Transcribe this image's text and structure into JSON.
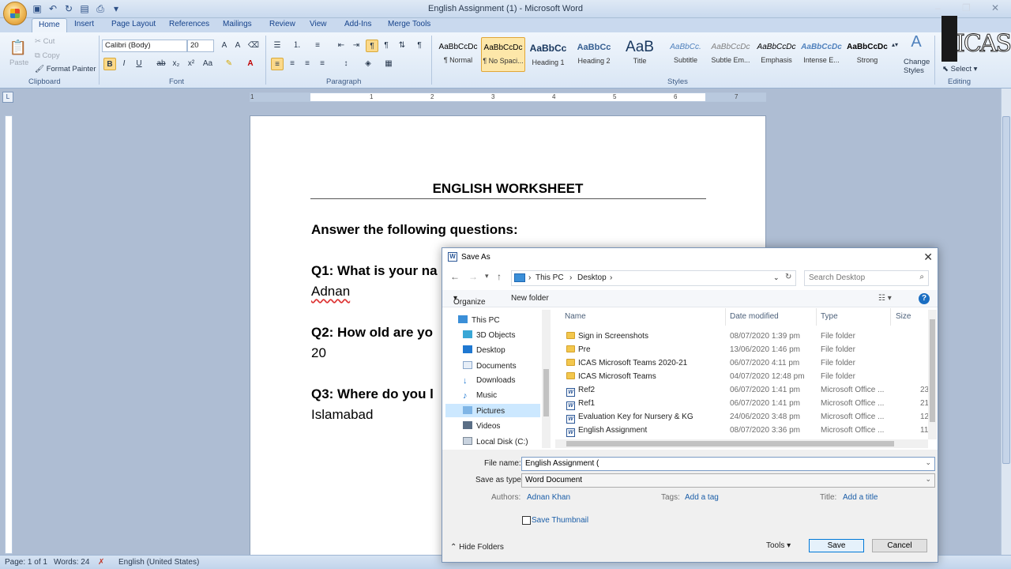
{
  "window": {
    "title": "English Assignment (1) - Microsoft Word"
  },
  "ribbon": {
    "tabs": [
      "Home",
      "Insert",
      "Page Layout",
      "References",
      "Mailings",
      "Review",
      "View",
      "Add-Ins",
      "Merge Tools"
    ],
    "clipboard": {
      "paste": "Paste",
      "cut": "Cut",
      "copy": "Copy",
      "format_painter": "Format Painter",
      "label": "Clipboard"
    },
    "font": {
      "name": "Calibri (Body)",
      "size": "20",
      "label": "Font"
    },
    "paragraph": {
      "label": "Paragraph"
    },
    "styles": {
      "items": [
        {
          "preview": "AaBbCcDc",
          "name": "¶ Normal"
        },
        {
          "preview": "AaBbCcDc",
          "name": "¶ No Spaci..."
        },
        {
          "preview": "AaBbCc",
          "name": "Heading 1"
        },
        {
          "preview": "AaBbCc",
          "name": "Heading 2"
        },
        {
          "preview": "AaB",
          "name": "Title"
        },
        {
          "preview": "AaBbCc.",
          "name": "Subtitle"
        },
        {
          "preview": "AaBbCcDc",
          "name": "Subtle Em..."
        },
        {
          "preview": "AaBbCcDc",
          "name": "Emphasis"
        },
        {
          "preview": "AaBbCcDc",
          "name": "Intense E..."
        },
        {
          "preview": "AaBbCcDc",
          "name": "Strong"
        }
      ],
      "change_styles": "Change Styles",
      "label": "Styles"
    },
    "editing": {
      "select": "Select",
      "label": "Editing"
    }
  },
  "ruler": {
    "numbers": [
      "1",
      "1",
      "2",
      "3",
      "4",
      "5",
      "6",
      "7"
    ]
  },
  "document": {
    "title": "ENGLISH WORKSHEET",
    "lines": [
      {
        "text": "Answer the following questions:",
        "bold": true
      },
      {
        "text": "Q1: What is your na",
        "bold": true
      },
      {
        "text": "Adnan",
        "bold": false
      },
      {
        "text": "Q2: How old are yo",
        "bold": true
      },
      {
        "text": "20",
        "bold": false
      },
      {
        "text": "Q3: Where do you l",
        "bold": true
      },
      {
        "text": "Islamabad",
        "bold": false
      }
    ]
  },
  "status": {
    "page": "Page: 1 of 1",
    "words": "Words: 24",
    "language": "English (United States)"
  },
  "dialog": {
    "title": "Save As",
    "address": {
      "crumbs": [
        "This PC",
        "Desktop"
      ]
    },
    "search_placeholder": "Search Desktop",
    "toolbar": {
      "organize": "Organize",
      "new_folder": "New folder"
    },
    "nav": [
      "This PC",
      "3D Objects",
      "Desktop",
      "Documents",
      "Downloads",
      "Music",
      "Pictures",
      "Videos",
      "Local Disk (C:)"
    ],
    "columns": [
      "Name",
      "Date modified",
      "Type",
      "Size"
    ],
    "files": [
      {
        "name": "Sign in Screenshots",
        "date": "08/07/2020 1:39 pm",
        "type": "File folder",
        "size": "",
        "kind": "folder"
      },
      {
        "name": "Pre",
        "date": "13/06/2020 1:46 pm",
        "type": "File folder",
        "size": "",
        "kind": "folder"
      },
      {
        "name": "ICAS Microsoft Teams 2020-21",
        "date": "06/07/2020 4:11 pm",
        "type": "File folder",
        "size": "",
        "kind": "folder"
      },
      {
        "name": "ICAS Microsoft Teams",
        "date": "04/07/2020 12:48 pm",
        "type": "File folder",
        "size": "",
        "kind": "folder"
      },
      {
        "name": "Ref2",
        "date": "06/07/2020 1:41 pm",
        "type": "Microsoft Office ...",
        "size": "23",
        "kind": "word"
      },
      {
        "name": "Ref1",
        "date": "06/07/2020 1:41 pm",
        "type": "Microsoft Office ...",
        "size": "21",
        "kind": "word"
      },
      {
        "name": "Evaluation Key for Nursery & KG",
        "date": "24/06/2020 3:48 pm",
        "type": "Microsoft Office ...",
        "size": "12",
        "kind": "word"
      },
      {
        "name": "English Assignment",
        "date": "08/07/2020 3:36 pm",
        "type": "Microsoft Office ...",
        "size": "11",
        "kind": "word"
      }
    ],
    "file_name_label": "File name:",
    "file_name_value": "English Assignment (",
    "save_type_label": "Save as type:",
    "save_type_value": "Word Document",
    "authors_label": "Authors:",
    "authors_value": "Adnan Khan",
    "tags_label": "Tags:",
    "tags_value": "Add a tag",
    "title_label": "Title:",
    "title_value": "Add a title",
    "save_thumbnail": "Save Thumbnail",
    "hide_folders": "Hide Folders",
    "tools": "Tools",
    "save": "Save",
    "cancel": "Cancel"
  },
  "logo": {
    "text": "ICAS"
  }
}
